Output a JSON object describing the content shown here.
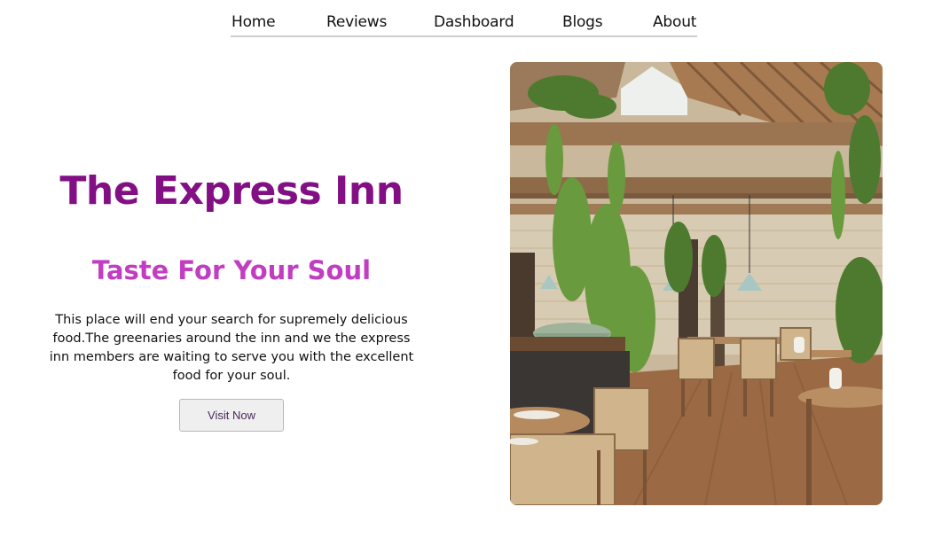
{
  "nav": {
    "items": [
      {
        "label": "Home"
      },
      {
        "label": "Reviews"
      },
      {
        "label": "Dashboard"
      },
      {
        "label": "Blogs"
      },
      {
        "label": "About"
      }
    ]
  },
  "hero": {
    "title": "The Express Inn",
    "subtitle": "Taste For Your Soul",
    "description": "This place will end your search for supremely delicious food.The greenaries around the inn and we the express inn members are waiting to serve you with the excellent food for your soul.",
    "cta_label": "Visit Now"
  },
  "colors": {
    "title": "#830f85",
    "subtitle": "#c13ec2",
    "nav_underline": "#cfcfcf"
  }
}
